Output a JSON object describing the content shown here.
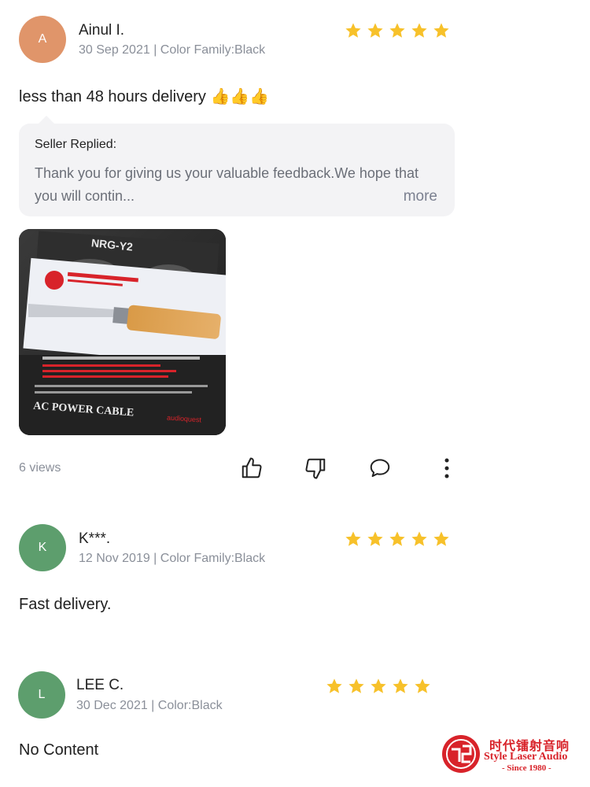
{
  "reviews": [
    {
      "avatar_letter": "A",
      "avatar_color": "#e0956a",
      "name": "Ainul I.",
      "meta": "30 Sep 2021 | Color Family:Black",
      "rating": 5,
      "text": "less than 48 hours delivery 👍👍👍",
      "reply": {
        "title": "Seller Replied:",
        "text": "Thank you for giving us your valuable feedback.We hope that you will contin...",
        "more": "more"
      },
      "photo": {
        "brand_label": "NRG-Y2",
        "product_label": "AC POWER CABLE",
        "maker": "audioquest"
      },
      "views": "6 views"
    },
    {
      "avatar_letter": "K",
      "avatar_color": "#5d9e6d",
      "name": "K***.",
      "meta": "12 Nov 2019 | Color Family:Black",
      "rating": 5,
      "text": "Fast delivery."
    },
    {
      "avatar_letter": "L",
      "avatar_color": "#5d9e6d",
      "name": "LEE C.",
      "meta": "30 Dec 2021 | Color:Black",
      "rating": 5,
      "text": "No Content"
    }
  ],
  "actions": {
    "like_icon": "thumbs-up-icon",
    "dislike_icon": "thumbs-down-icon",
    "comment_icon": "comment-icon",
    "more_icon": "more-vertical-icon"
  },
  "watermark": {
    "chinese": "时代镭射音响",
    "english": "Style Laser Audio",
    "since": "- Since 1980 -"
  },
  "colors": {
    "star": "#f7c12a",
    "accent_red": "#d8232a"
  }
}
